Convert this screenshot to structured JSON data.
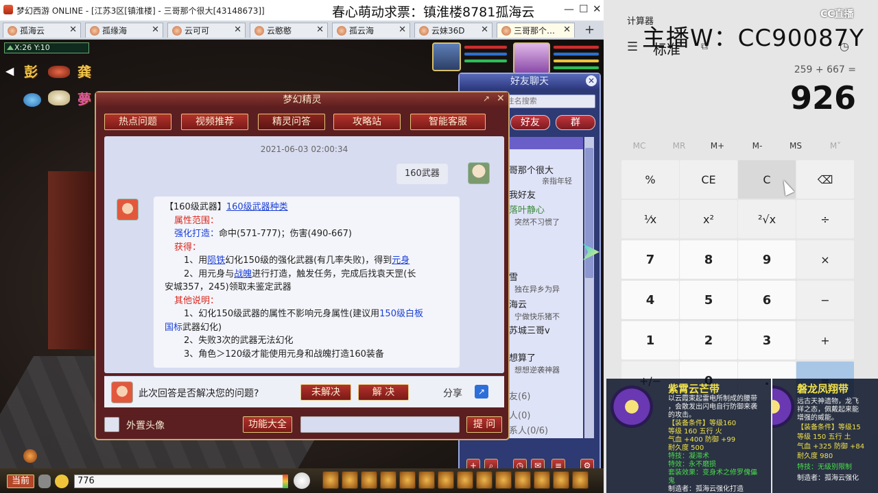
{
  "window": {
    "title": "梦幻西游 ONLINE - [江苏3区[镇淮楼] - 三哥那个很大[43148673]]",
    "promo": "春心萌动求票：镇淮楼8781孤海云"
  },
  "tabs": [
    "孤海云",
    "孤缘海",
    "云可可",
    "云憨憨",
    "孤云海",
    "云妹36D",
    "三哥那个…"
  ],
  "hud": {
    "coords": "X:26 Y:10",
    "side_icons": [
      "彭",
      "龚",
      "夢"
    ]
  },
  "dialog": {
    "title": "梦幻精灵",
    "tabs": [
      "热点问题",
      "视频推荐",
      "精灵问答",
      "攻略站",
      "智能客服"
    ],
    "timestamp": "2021-06-03 02:00:34",
    "question": "160武器",
    "answer": {
      "line1_prefix": "【160级武器】",
      "line1_link": "160级武器种类",
      "attr_header": "属性范围：",
      "forge_label": "强化打造：",
      "forge_value": "命中(571-777)；伤害(490-667)",
      "obtain_header": "获得：",
      "o1_a": "1、用",
      "o1_link1": "陨铁",
      "o1_b": "幻化150级的强化武器(有几率失败)，得到",
      "o1_link2": "元身",
      "o2_a": "2、用元身与",
      "o2_link": "战魄",
      "o2_b": "进行打造，触发任务，完成后找袁天罡(长",
      "o2_c": "安城357，245)领取未鉴定武器",
      "other_header": "其他说明：",
      "n1_a": "1、幻化150级武器的属性不影响元身属性(建议用",
      "n1_blue": "150级白板",
      "n1_c": "国标",
      "n1_d": "武器幻化)",
      "n2": "2、失败3次的武器无法幻化",
      "n3": "3、角色＞120级才能使用元身和战魄打造160装备"
    },
    "feedback_question": "此次回答是否解决您的问题?",
    "btn_unsolved": "未解决",
    "btn_solved": "解 决",
    "share": "分享",
    "external_avatar": "外置头像",
    "btn_functions": "功能大全",
    "btn_ask": "提 问"
  },
  "friends": {
    "title": "好友聊天",
    "search_placeholder": "名、ID、备注名搜索",
    "tab_friends": "好友",
    "tab_group": "群",
    "items": [
      {
        "name": "哥那个很大",
        "status": "亲指年轻"
      },
      {
        "name": "我好友",
        "status": ""
      },
      {
        "name": "落叶静心",
        "status": "突然不习惯了"
      },
      {
        "name": "雪",
        "status": "独在异乡为异"
      },
      {
        "name": "海云",
        "status": "宁做快乐猪不"
      },
      {
        "name": "苏城三哥v",
        "status": ""
      },
      {
        "name": "想算了",
        "status": "想想逆袭神器"
      },
      {
        "name": "友(6)",
        "status": ""
      },
      {
        "name": "人(0)",
        "status": ""
      },
      {
        "name": "系人(0/6)",
        "status": ""
      }
    ]
  },
  "chat_input": {
    "channel": "当前",
    "value": "776"
  },
  "calculator": {
    "label": "计算器",
    "mode": "标准",
    "expression": "259 + 667 =",
    "result": "926",
    "memory": [
      "MC",
      "MR",
      "M+",
      "M-",
      "MS",
      "M˅"
    ],
    "keys": [
      "%",
      "CE",
      "C",
      "⌫",
      "¹⁄x",
      "x²",
      "²√x",
      "÷",
      "7",
      "8",
      "9",
      "×",
      "4",
      "5",
      "6",
      "−",
      "1",
      "2",
      "3",
      "+",
      "+/−",
      "0",
      ".",
      "="
    ]
  },
  "overlay": {
    "streamer": "主播W：CC90087Y",
    "logo": "CC直播",
    "item1": {
      "name": "紫霄云芒带",
      "lines": [
        "以云霞束起雷电所制成的腰带",
        "，会散发出闪电自行防御来袭",
        "的攻击。",
        "【装备条件】等级160",
        "等级 160  五行 火",
        "气血 +400 防御 +99",
        "耐久度 500",
        "特技：凝滞术",
        "特效：永不磨损",
        "套装效果：变身术之修罗傀儡",
        "鬼",
        "制造者：孤海云强化打造"
      ]
    },
    "item2": {
      "name": "磐龙凤翔带",
      "lines": [
        "远古天神遗物，龙飞",
        "祥之态，佩戴起来能",
        "增强的威能。",
        "【装备条件】等级15",
        "等级 150  五行 土",
        "气血 +325 防御 +84",
        "耐久度 980",
        "特技：无级别限制",
        "制造者：孤海云强化"
      ]
    }
  }
}
